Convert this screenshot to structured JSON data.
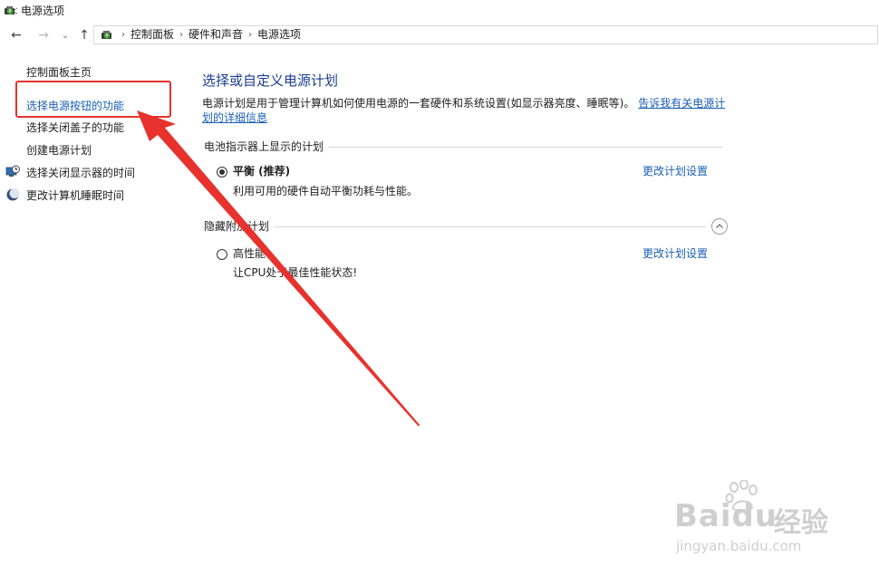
{
  "window": {
    "title": "电源选项"
  },
  "navigation": {
    "back_glyph": "←",
    "forward_glyph": "→",
    "dropdown_glyph": "⌄",
    "up_glyph": "↑",
    "breadcrumbs": [
      "控制面板",
      "硬件和声音",
      "电源选项"
    ],
    "separator": "›"
  },
  "sidebar": {
    "items": [
      {
        "label": "控制面板主页",
        "link": false
      },
      {
        "label": "选择电源按钮的功能",
        "link": true
      },
      {
        "label": "选择关闭盖子的功能",
        "link": false
      },
      {
        "label": "创建电源计划",
        "link": false
      },
      {
        "label": "选择关闭显示器的时间",
        "link": false,
        "icon": "display-clock-icon"
      },
      {
        "label": "更改计算机睡眠时间",
        "link": false,
        "icon": "moon-icon"
      }
    ]
  },
  "main": {
    "title": "选择或自定义电源计划",
    "description_text": "电源计划是用于管理计算机如何使用电源的一套硬件和系统设置(如显示器亮度、睡眠等)。",
    "description_link_part1": "告诉我有关电源计",
    "description_link_part2": "划的详细信息",
    "battery_section_title": "电池指示器上显示的计划",
    "plan_balanced": {
      "name": "平衡 (推荐)",
      "description": "利用可用的硬件自动平衡功耗与性能。",
      "change_link": "更改计划设置",
      "selected": true
    },
    "hidden_section_title": "隐藏附加计划",
    "plan_high": {
      "name": "高性能",
      "description": "让CPU处于最佳性能状态!",
      "change_link": "更改计划设置",
      "selected": false
    }
  },
  "watermark": {
    "brand": "Baidu",
    "brand_cn": "经验",
    "url": "jingyan.baidu.com"
  },
  "colors": {
    "link": "#1a5fb4",
    "title_blue": "#1a3d8f",
    "annotation_red": "#e8322d"
  }
}
